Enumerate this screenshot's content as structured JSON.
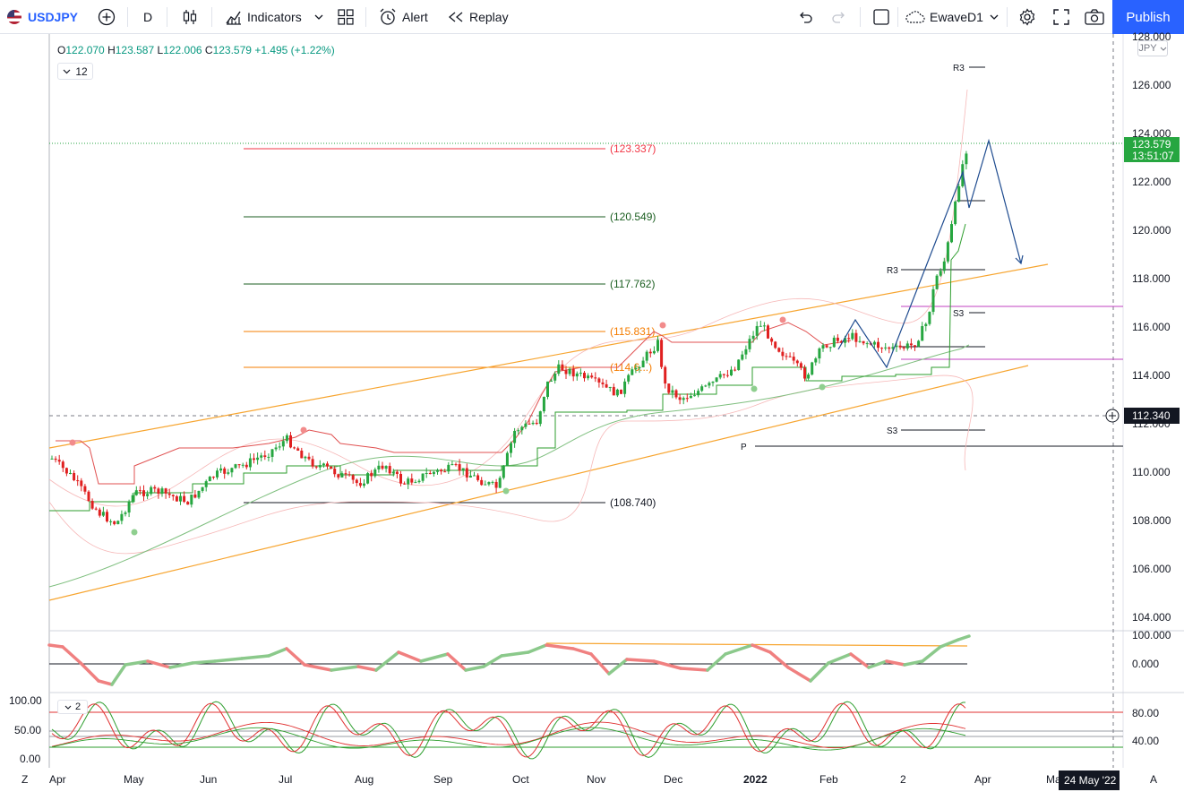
{
  "toolbar": {
    "symbol": "USDJPY",
    "interval": "D",
    "indicators_label": "Indicators",
    "alert_label": "Alert",
    "replay_label": "Replay",
    "layout_name": "EwaveD1",
    "publish_label": "Publish"
  },
  "legend": {
    "o_label": "O",
    "o": "122.070",
    "h_label": "H",
    "h": "123.587",
    "l_label": "L",
    "l": "122.006",
    "c_label": "C",
    "c": "123.579",
    "change": "+1.495 (+1.22%)"
  },
  "indicator_buttons": {
    "main_count": "12",
    "stoch_count": "2"
  },
  "currency_badge": "JPY",
  "price_axis": {
    "ticks": [
      "128.000",
      "126.000",
      "124.000",
      "122.000",
      "120.000",
      "118.000",
      "116.000",
      "114.000",
      "112.000",
      "110.000",
      "108.000",
      "106.000",
      "104.000"
    ],
    "last_price": "123.579",
    "countdown": "13:51:07",
    "crosshair_price": "112.340"
  },
  "time_axis": {
    "labels": [
      "Apr",
      "May",
      "Jun",
      "Jul",
      "Aug",
      "Sep",
      "Oct",
      "Nov",
      "Dec",
      "2022",
      "Feb",
      "2",
      "Apr",
      "Ma"
    ],
    "crosshair_date": "24 May '22",
    "left_button": "Z",
    "right_button": "A"
  },
  "fib_levels": [
    {
      "label": "(123.337)",
      "color": "#f23645"
    },
    {
      "label": "(120.549)",
      "color": "#1b5e20"
    },
    {
      "label": "(117.762)",
      "color": "#1b5e20"
    },
    {
      "label": "(115.831)",
      "color": "#f57c00"
    },
    {
      "label": "(114.6...)",
      "color": "#f57c00"
    },
    {
      "label": "(108.740)",
      "color": "#131722"
    }
  ],
  "pivot_labels": {
    "r3_top": "R3",
    "r3_mid": "R3",
    "s3_mid": "S3",
    "s3_low": "S3",
    "p": "P"
  },
  "osc_axis": {
    "ticks": [
      "100.000",
      "0.000"
    ]
  },
  "stoch_axis": {
    "left_ticks": [
      "100.00",
      "50.00",
      "0.00"
    ],
    "right_ticks": [
      "80.00",
      "40.00"
    ]
  },
  "colors": {
    "up": "#26a640",
    "down": "#e02020",
    "accent": "#2962ff",
    "channel": "#f7a530"
  }
}
